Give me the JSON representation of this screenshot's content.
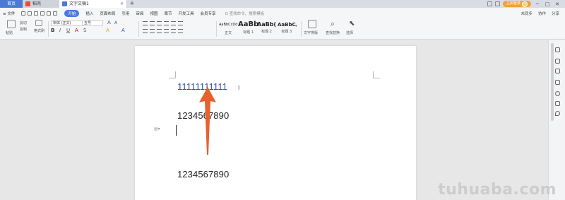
{
  "tabs": {
    "home": "首页",
    "doc": "稻壳",
    "active": "文字文稿1",
    "add": "+"
  },
  "titlebar": {
    "login": "立即登录"
  },
  "menu": {
    "file": "≡ 文件",
    "start": "开始",
    "items": [
      "插入",
      "页面布局",
      "引用",
      "审阅",
      "视图",
      "章节",
      "开发工具",
      "会员专享"
    ],
    "search": "Q 查找命令、搜索模板",
    "right": [
      "未同步",
      "协作",
      "分享"
    ]
  },
  "ribbon": {
    "cut": "剪切",
    "copy": "复制",
    "format_painter": "格式刷",
    "paste": "粘贴",
    "font_name": "宋体 (正文)",
    "font_size": "五号",
    "bold": "B",
    "italic": "I",
    "underline": "U",
    "styles": [
      {
        "sample": "AaBbCcDd",
        "name": "正文"
      },
      {
        "sample": "AaBb",
        "name": "标题 1"
      },
      {
        "sample": "AaBb(",
        "name": "标题 2"
      },
      {
        "sample": "AaBbC",
        "name": "标题 3"
      }
    ],
    "text_layout": "文字排版",
    "find_replace": "查找替换",
    "select": "选择"
  },
  "document": {
    "lines": [
      "11111111111",
      "1234567890",
      "1234567890"
    ]
  },
  "watermark": "tuhuaba.com",
  "colors": {
    "accent": "#4a79d6",
    "arrow": "#e8602c",
    "blue_text": "#2c4ea7",
    "login": "#f2a23c"
  }
}
